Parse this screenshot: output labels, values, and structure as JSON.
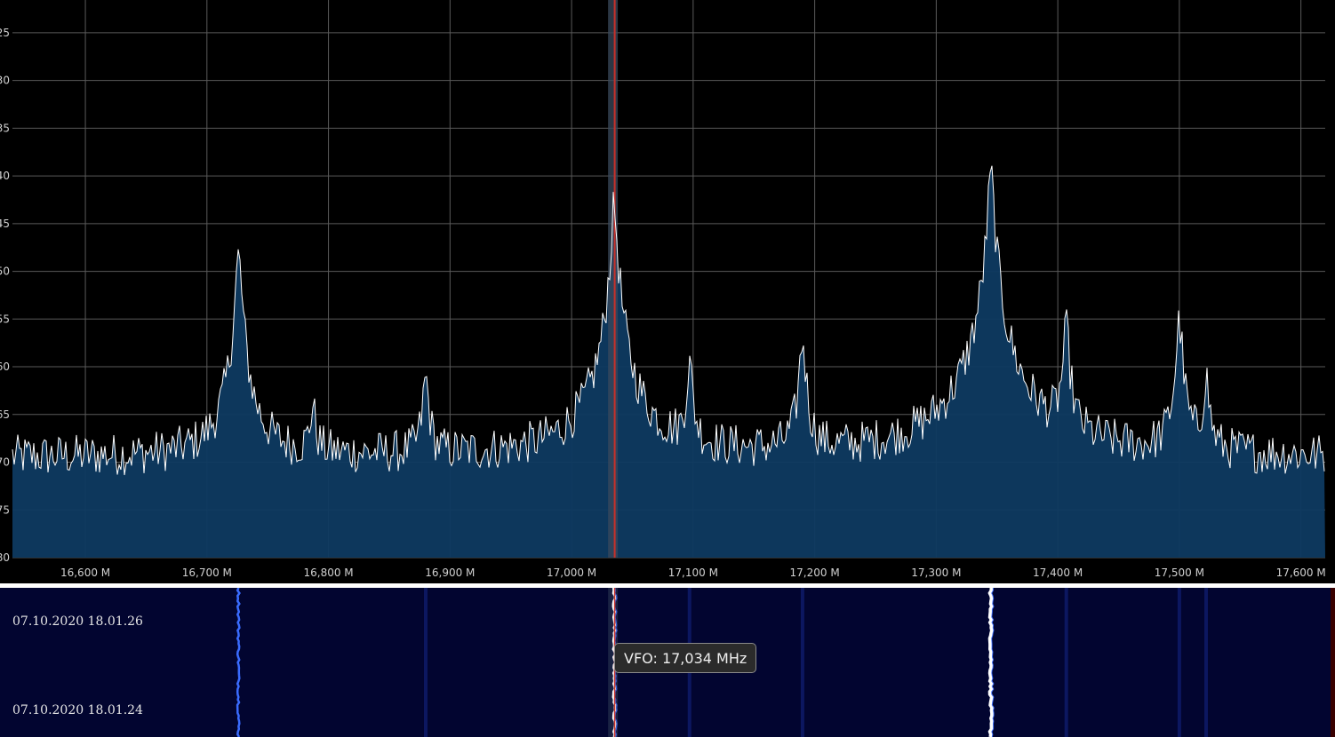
{
  "spectrum": {
    "freq_range_mhz": [
      16.54,
      17.62
    ],
    "power_range_db": [
      -80,
      -22.5
    ],
    "y_tick_labels": [
      "25",
      "30",
      "35",
      "40",
      "45",
      "50",
      "55",
      "60",
      "65",
      "70",
      "75",
      "80"
    ],
    "y_tick_values": [
      -25,
      -30,
      -35,
      -40,
      -45,
      -50,
      -55,
      -60,
      -65,
      -70,
      -75,
      -80
    ],
    "x_ticks": [
      {
        "mhz": 16.6,
        "label": "16,600 M"
      },
      {
        "mhz": 16.7,
        "label": "16,700 M"
      },
      {
        "mhz": 16.8,
        "label": "16,800 M"
      },
      {
        "mhz": 16.9,
        "label": "16,900 M"
      },
      {
        "mhz": 17.0,
        "label": "17,000 M"
      },
      {
        "mhz": 17.1,
        "label": "17,100 M"
      },
      {
        "mhz": 17.2,
        "label": "17,200 M"
      },
      {
        "mhz": 17.3,
        "label": "17,300 M"
      },
      {
        "mhz": 17.4,
        "label": "17,400 M"
      },
      {
        "mhz": 17.5,
        "label": "17,500 M"
      },
      {
        "mhz": 17.6,
        "label": "17,600 M"
      }
    ],
    "noise_floor_db": -69.5,
    "peaks": [
      {
        "mhz": 16.726,
        "db": -48.5
      },
      {
        "mhz": 16.787,
        "db": -66.0
      },
      {
        "mhz": 16.88,
        "db": -62.0
      },
      {
        "mhz": 17.035,
        "db": -43.5
      },
      {
        "mhz": 17.097,
        "db": -60.5
      },
      {
        "mhz": 17.19,
        "db": -57.5
      },
      {
        "mhz": 17.345,
        "db": -40.0
      },
      {
        "mhz": 17.407,
        "db": -56.5
      },
      {
        "mhz": 17.5,
        "db": -55.5
      },
      {
        "mhz": 17.522,
        "db": -62.0
      }
    ],
    "vfo_mhz": 17.034,
    "vfo_band_mhz": [
      17.03,
      17.038
    ],
    "colors": {
      "fill": "#0e3a61",
      "trace": "#ffffff",
      "grid": "#5a5a5a",
      "vfo_line": "#c8302a",
      "vfo_band": "#3a4a5c",
      "labels": "#d0d0d0"
    }
  },
  "waterfall": {
    "timestamps": [
      "07.10.2020 18.01.26",
      "07.10.2020 18.01.24"
    ],
    "vfo_tooltip": "VFO: 17,034 MHz",
    "bright_lines_mhz": [
      16.726,
      17.035,
      17.345
    ],
    "faint_lines_mhz": [
      16.88,
      17.097,
      17.19,
      17.407,
      17.5,
      17.522
    ],
    "colors": {
      "background": "#020530",
      "strong": "#ffffff",
      "medium": "#3a6cff",
      "faint": "#0d1a66"
    }
  }
}
